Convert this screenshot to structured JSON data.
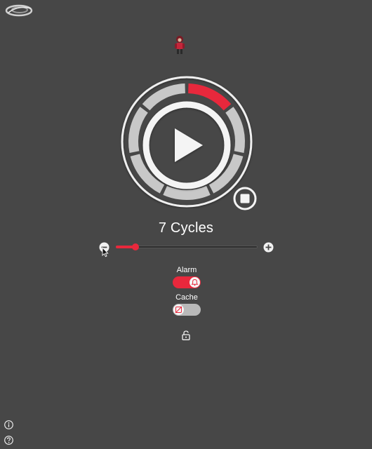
{
  "app": {
    "logo_icon": "swirl-logo-icon",
    "character_icon": "red-hooded-character-icon"
  },
  "timer": {
    "play_icon": "play-icon",
    "stop_icon": "stop-icon",
    "segments_total": 7,
    "segments_active": 1,
    "active_color": "#e8283c",
    "inactive_color": "#c8c8c8"
  },
  "cycles": {
    "label": "7 Cycles",
    "min_icon": "minus-circle-icon",
    "plus_icon": "plus-circle-icon",
    "slider_fraction": 0.14
  },
  "toggles": {
    "alarm": {
      "label": "Alarm",
      "on": true,
      "icon": "bell-icon"
    },
    "cache": {
      "label": "Cache",
      "on": false,
      "icon": "no-cache-icon"
    }
  },
  "footer": {
    "lock_icon": "unlock-icon",
    "info_icon": "info-icon",
    "help_icon": "help-icon"
  },
  "colors": {
    "background": "#474747",
    "accent": "#e8283c"
  }
}
